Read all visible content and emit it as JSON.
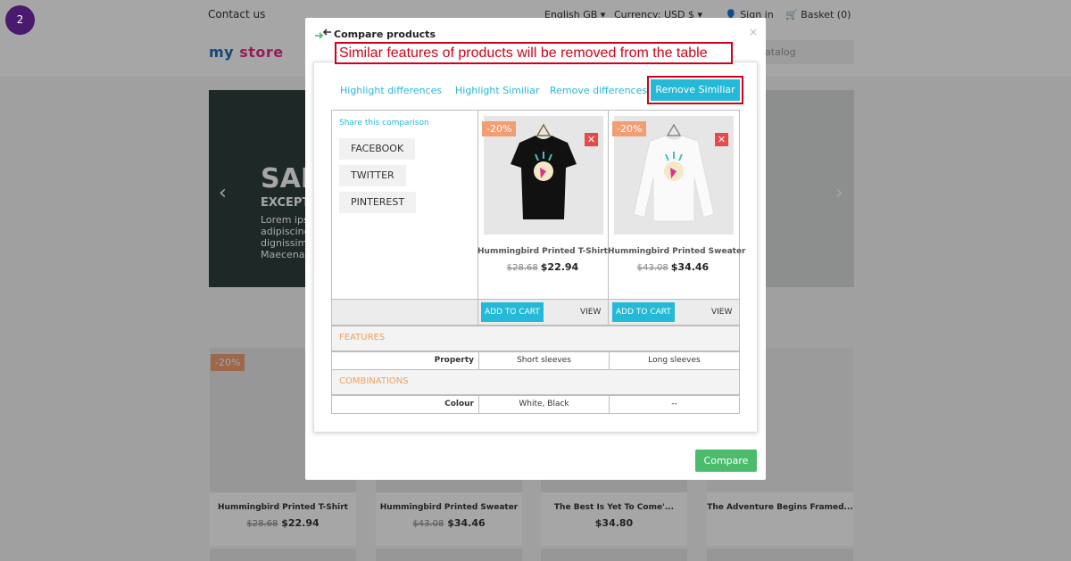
{
  "step": "2",
  "background": {
    "contact": "Contact us",
    "language": "English GB ▾",
    "currency": "Currency: USD $ ▾",
    "sign_in": "Sign in",
    "basket": "Basket (0)",
    "logo_my": "my",
    "logo_store": "store",
    "search_placeholder": "r catalog",
    "slide_title": "SAM",
    "slide_subtitle": "EXCEPT",
    "slide_text": "Lorem ips adipiscing dignissim Maecena",
    "cards": [
      {
        "title": "Hummingbird Printed T-Shirt",
        "old_price": "$28.68",
        "price": "$22.94"
      },
      {
        "title": "Hummingbird Printed Sweater",
        "old_price": "$43.08",
        "price": "$34.46"
      },
      {
        "title": "The Best Is Yet To Come'...",
        "old_price": "",
        "price": "$34.80"
      },
      {
        "title": "The Adventure Begins Framed...",
        "old_price": "",
        "price": ""
      }
    ],
    "card_badge": "-20%"
  },
  "modal": {
    "title": "Compare products",
    "close": "×",
    "annotation": "Similar features of products will be removed from the table",
    "tabs": [
      "Highlight differences",
      "Highlight Similiar",
      "Remove differences",
      "Remove Similiar"
    ],
    "share_label": "Share this comparison",
    "share_buttons": [
      "FACEBOOK",
      "TWITTER",
      "PINTEREST"
    ],
    "products": [
      {
        "badge": "-20%",
        "name": "Hummingbird Printed T-Shirt",
        "old_price": "$28.68",
        "price": "$22.94",
        "add_to_cart": "ADD TO CART",
        "view": "VIEW"
      },
      {
        "badge": "-20%",
        "name": "Hummingbird Printed Sweater",
        "old_price": "$43.08",
        "price": "$34.46",
        "add_to_cart": "ADD TO CART",
        "view": "VIEW"
      }
    ],
    "sections": {
      "features": "FEATURES",
      "combinations": "COMBINATIONS"
    },
    "rows": {
      "property": {
        "label": "Property",
        "values": [
          "Short sleeves",
          "Long sleeves"
        ]
      },
      "colour": {
        "label": "Colour",
        "values": [
          "White, Black",
          "--"
        ]
      }
    },
    "compare_button": "Compare"
  },
  "colors": {
    "accent": "#24b9d7",
    "annotation": "#d0021b",
    "compare": "#4cbb6c",
    "badge": "#f39d72"
  }
}
